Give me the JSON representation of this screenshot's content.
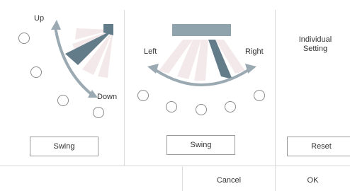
{
  "vertical": {
    "up_label": "Up",
    "down_label": "Down",
    "swing_label": "Swing",
    "position_count": 5
  },
  "horizontal": {
    "left_label": "Left",
    "right_label": "Right",
    "swing_label": "Swing",
    "position_count": 5
  },
  "individual": {
    "title": "Individual Setting",
    "reset_label": "Reset"
  },
  "footer": {
    "cancel_label": "Cancel",
    "ok_label": "OK"
  },
  "colors": {
    "blade_active": "#637c8a",
    "blade_inactive": "#f3e9ea",
    "arrow": "#9aa9b2",
    "unit": "#8fa3ad"
  }
}
